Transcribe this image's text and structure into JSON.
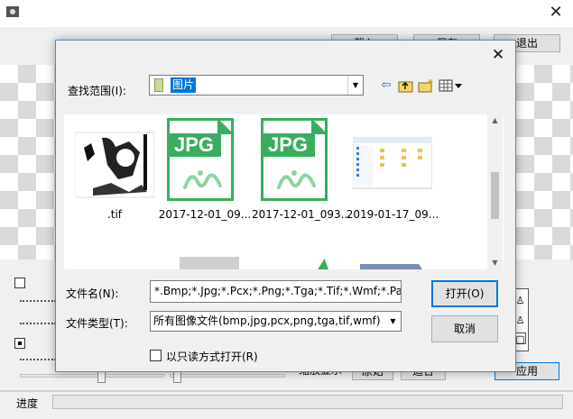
{
  "main": {
    "buttons": {
      "load_label": "载入",
      "save_label": "保存",
      "exit_label": "退出",
      "zoom_label": "缩放显示",
      "original_label": "原始",
      "fit_label": "适合",
      "apply_label": "应用"
    },
    "progress_label": "进度"
  },
  "dialog": {
    "look_in_label": "查找范围(I):",
    "look_in_value": "图片",
    "files": [
      {
        "name": ".tif",
        "kind": "image"
      },
      {
        "name": "2017-12-01_09...",
        "kind": "jpg",
        "badge": "JPG"
      },
      {
        "name": "2017-12-01_093...",
        "kind": "jpg",
        "badge": "JPG"
      },
      {
        "name": "2019-01-17_09...",
        "kind": "screenshot"
      }
    ],
    "filename_label": "文件名(N):",
    "filename_value": "*.Bmp;*.Jpg;*.Pcx;*.Png;*.Tga;*.Tif;*.Wmf;*.Pax",
    "filetype_label": "文件类型(T):",
    "filetype_value": "所有图像文件(bmp,jpg,pcx,png,tga,tif,wmf)",
    "open_label": "打开(O)",
    "cancel_label": "取消",
    "readonly_label": "以只读方式打开(R)"
  },
  "colors": {
    "accent": "#0078d7",
    "jpg_green": "#39ae5f",
    "dialog_border": "#4a8ac6"
  }
}
